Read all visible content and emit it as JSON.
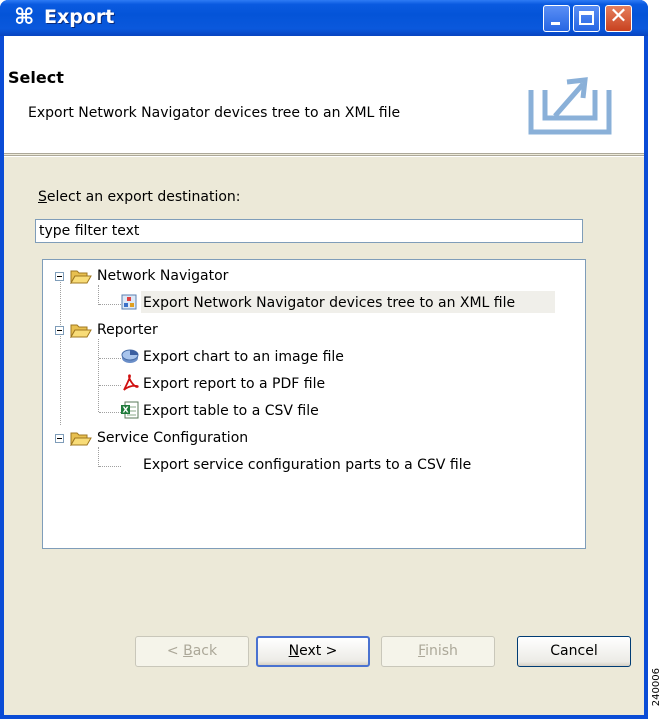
{
  "window": {
    "title": "Export",
    "title_icon": "wizard-icon"
  },
  "header": {
    "title": "Select",
    "description": "Export Network Navigator devices tree to an XML file",
    "icon": "export-wizard-icon"
  },
  "destination": {
    "label_prefix": "S",
    "label_rest": "elect an export destination:",
    "filter_value": "type filter text"
  },
  "tree": {
    "groups": [
      {
        "label": "Network Navigator",
        "expanded": true,
        "items": [
          {
            "label": "Export Network Navigator devices tree to an XML file",
            "icon": "network-navigator-icon",
            "selected": true
          }
        ]
      },
      {
        "label": "Reporter",
        "expanded": true,
        "items": [
          {
            "label": "Export chart to an image file",
            "icon": "chart-icon"
          },
          {
            "label": "Export report to a PDF file",
            "icon": "pdf-icon"
          },
          {
            "label": "Export table to a CSV file",
            "icon": "excel-icon"
          }
        ]
      },
      {
        "label": "Service Configuration",
        "expanded": true,
        "items": [
          {
            "label": "Export service configuration parts to a CSV file",
            "icon": ""
          }
        ]
      }
    ]
  },
  "buttons": {
    "back_prefix": "< ",
    "back_key": "B",
    "back_rest": "ack",
    "next_key": "N",
    "next_rest": "ext >",
    "finish_key": "F",
    "finish_rest": "inish",
    "cancel": "Cancel"
  },
  "side_tag": "240006"
}
